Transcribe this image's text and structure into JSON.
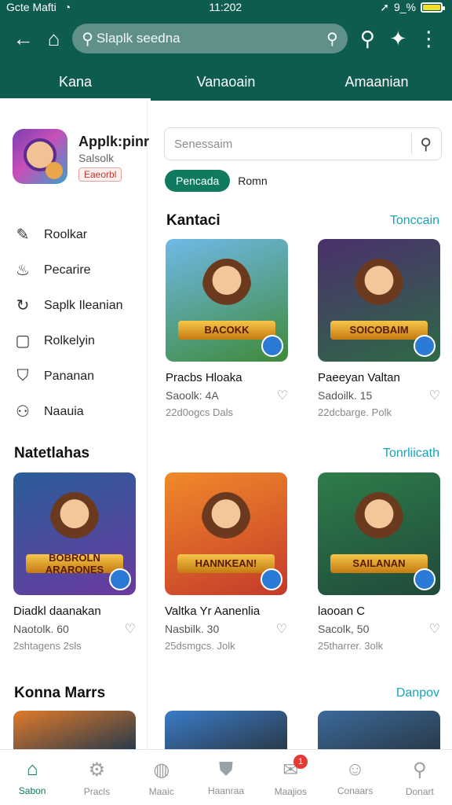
{
  "status": {
    "carrier": "Gcte Mafti",
    "time": "11:202",
    "battery": "9_%",
    "battery_level": 0.9
  },
  "appbar": {
    "back_icon": "arrow-left-icon",
    "home_icon": "home-icon",
    "search_text": "Slaplk seedna",
    "search_icon": "search-icon",
    "actions": [
      "search-icon",
      "accessibility-icon",
      "more-vert-icon"
    ]
  },
  "tabs": [
    {
      "label": "Kana",
      "active": true
    },
    {
      "label": "Vanaoain",
      "active": false
    },
    {
      "label": "Amaanian",
      "active": false
    }
  ],
  "sidebar": {
    "profile": {
      "name": "Applk:pinr",
      "subtitle": "Salsolk",
      "badge": "Eaeorbl"
    },
    "items": [
      {
        "label": "Roolkar",
        "icon": "edit-box-icon"
      },
      {
        "label": "Pecarire",
        "icon": "flame-icon"
      },
      {
        "label": "Saplk Ileanian",
        "icon": "refresh-icon"
      },
      {
        "label": "Rolkelyin",
        "icon": "square-icon"
      },
      {
        "label": "Pananan",
        "icon": "people-icon"
      },
      {
        "label": "Naauia",
        "icon": "person-icon"
      }
    ]
  },
  "main": {
    "search_placeholder": "Senessaim",
    "chips": {
      "active": "Pencada",
      "other": "Romn"
    }
  },
  "sections": [
    {
      "title": "Kantaci",
      "link": "Tonccain",
      "cards": [
        {
          "title": "Pracbs Hloaka",
          "sub": "Saoolk: 4A",
          "meta": "22d0ogcs Dals",
          "banner": "BACOKK",
          "colors": [
            "#6fb9e8",
            "#3f8a3a"
          ]
        },
        {
          "title": "Paeeyan Valtan",
          "sub": "Sadoilk. 15",
          "meta": "22dcbarge. Polk",
          "banner": "SOICOBAIM",
          "colors": [
            "#4b2f6d",
            "#2e6a45"
          ]
        }
      ]
    },
    {
      "title": "Natetlahas",
      "link": "Tonrliicath",
      "cards": [
        {
          "title": "Diadkl daanakan",
          "sub": "Naotolk. 60",
          "meta": "2shtagens 2sls",
          "banner": "BOBROLN ARARONES",
          "colors": [
            "#2a5d9a",
            "#6a3aa0"
          ]
        },
        {
          "title": "Valtka Yr Aanenlia",
          "sub": "Nasbilk. 30",
          "meta": "25dsmgcs. Jolk",
          "banner": "HANNKEAN!",
          "colors": [
            "#f08a2a",
            "#c43a2a"
          ]
        },
        {
          "title": "laooan C",
          "sub": "Sacolk, 50",
          "meta": "25tharrer. 3olk",
          "banner": "SAILANAN",
          "colors": [
            "#2f7c4a",
            "#1f4a3a"
          ]
        }
      ]
    },
    {
      "title": "Konna Marrs",
      "link": "Danpov",
      "cards": []
    }
  ],
  "bottomnav": [
    {
      "label": "Sabon",
      "icon": "home-icon",
      "active": true
    },
    {
      "label": "Pracls",
      "icon": "gear-icon",
      "active": false
    },
    {
      "label": "Maaic",
      "icon": "compass-icon",
      "active": false
    },
    {
      "label": "Haanraa",
      "icon": "shield-icon",
      "active": false
    },
    {
      "label": "Maajios",
      "icon": "mail-icon",
      "active": false,
      "badge": "1"
    },
    {
      "label": "Conaars",
      "icon": "smile-icon",
      "active": false
    },
    {
      "label": "Donart",
      "icon": "search-icon",
      "active": false
    }
  ]
}
